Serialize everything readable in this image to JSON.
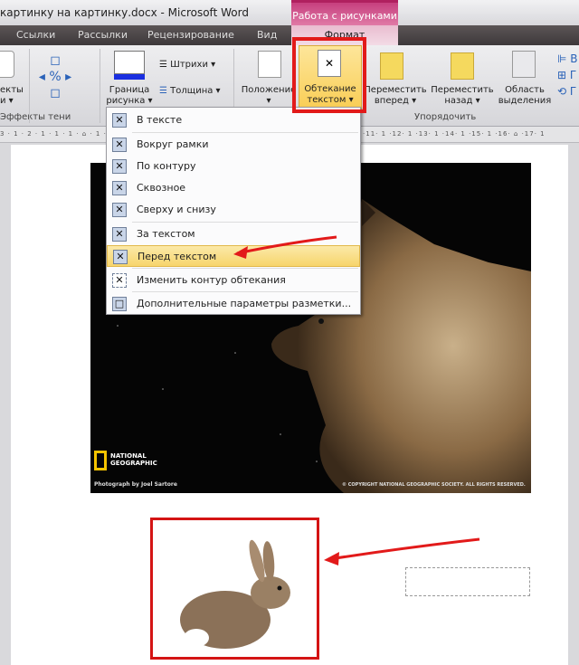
{
  "window": {
    "title": "картинку на картинку.docx - Microsoft Word",
    "context_tab": "Работа с рисунками"
  },
  "tabs": [
    "Ссылки",
    "Рассылки",
    "Рецензирование",
    "Вид",
    "Формат"
  ],
  "ribbon": {
    "effects": "екты\nи ▾",
    "shadow_group": "Эффекты тени",
    "border": "Граница\nрисунка ▾",
    "strokes": "Штрихи ▾",
    "thickness": "Толщина ▾",
    "position": "Положение\n▾",
    "wrap": "Обтекание\nтекстом ▾",
    "forward": "Переместить\nвперед ▾",
    "backward": "Переместить\nназад ▾",
    "selection": "Область\nвыделения",
    "arrange_group": "Упорядочить"
  },
  "ruler": "3 · 1 · 2 · 1 · 1 · 1 · ⌂ · 1 · 1 · 2 · 1 · 3 · 1 · 4 · 1 · 5 · 1 · 6 · 1 · 7 · 1 · 8 · 1 · 9 · 1 ·10· 1 ·11· 1 ·12· 1 ·13· 1 ·14· 1 ·15· 1 ·16· ⌂ ·17· 1",
  "menu": [
    {
      "label": "В тексте",
      "icon": "wrap-inline-icon"
    },
    {
      "label": "Вокруг рамки",
      "icon": "wrap-square-icon"
    },
    {
      "label": "По контуру",
      "icon": "wrap-tight-icon"
    },
    {
      "label": "Сквозное",
      "icon": "wrap-through-icon"
    },
    {
      "label": "Сверху и снизу",
      "icon": "wrap-top-bottom-icon"
    },
    {
      "label": "За текстом",
      "icon": "wrap-behind-icon"
    },
    {
      "label": "Перед текстом",
      "icon": "wrap-front-icon",
      "highlighted": true
    },
    {
      "label": "Изменить контур обтекания",
      "icon": "edit-wrap-points-icon"
    },
    {
      "label": "Дополнительные параметры разметки...",
      "icon": "layout-options-icon"
    }
  ],
  "photo": {
    "logo": "NATIONAL\nGEOGRAPHIC",
    "credit": "Photograph by Joel Sartore",
    "copyright": "© COPYRIGHT NATIONAL GEOGRAPHIC SOCIETY. ALL RIGHTS RESERVED."
  },
  "colors": {
    "accent_red": "#e21a1a",
    "context_pink": "#c63f7e",
    "highlight": "#f7d56c"
  }
}
